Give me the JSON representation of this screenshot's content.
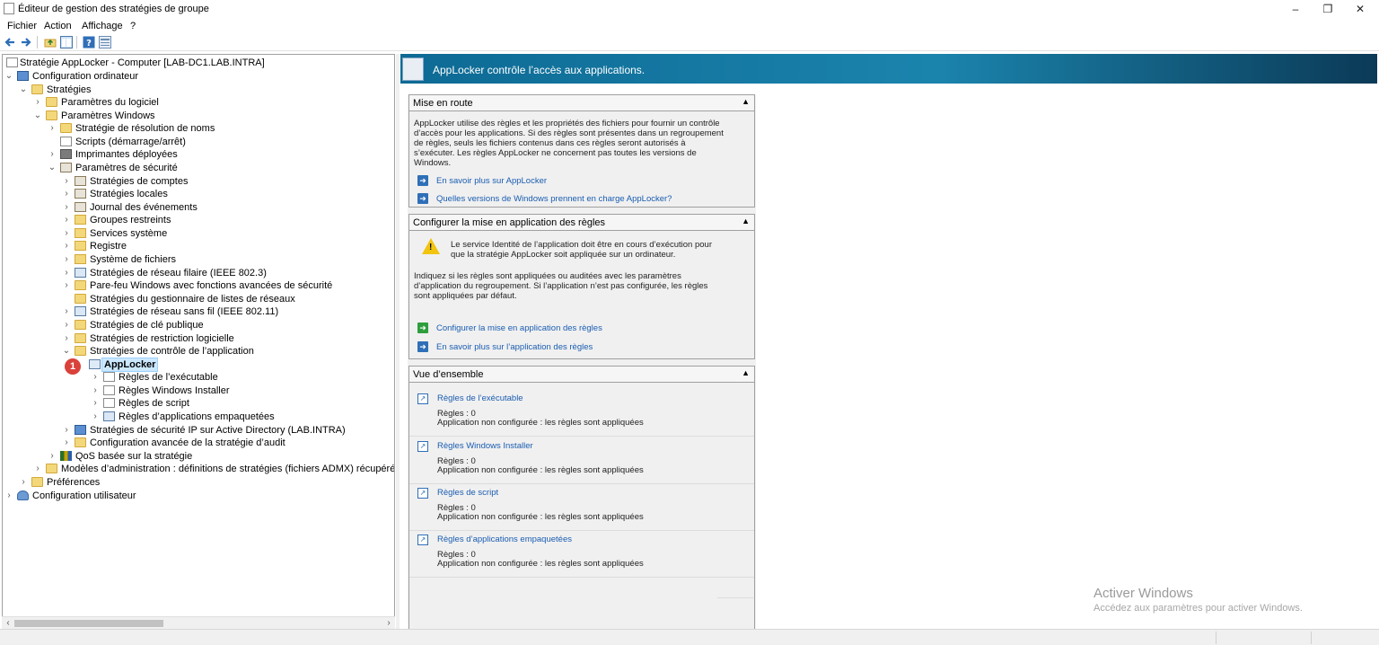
{
  "window": {
    "title": "Éditeur de gestion des stratégies de groupe",
    "minimize": "–",
    "restore": "❐",
    "close": "✕"
  },
  "menu": [
    "Fichier",
    "Action",
    "Affichage",
    "?"
  ],
  "toolbar": [
    "back-icon",
    "forward-icon",
    "up-folder-icon",
    "show-hide-tree-icon",
    "help-icon",
    "properties-icon"
  ],
  "tree": {
    "nodes": [
      {
        "label": "Stratégie AppLocker - Computer [LAB-DC1.LAB.INTRA]",
        "icon": "policy-icon"
      },
      {
        "label": "Configuration ordinateur",
        "icon": "computer-icon"
      },
      {
        "label": "Stratégies",
        "icon": "folder-icon"
      },
      {
        "label": "Paramètres du logiciel",
        "icon": "folder-icon"
      },
      {
        "label": "Paramètres Windows",
        "icon": "folder-icon"
      },
      {
        "label": "Stratégie de résolution de noms",
        "icon": "folder-icon"
      },
      {
        "label": "Scripts (démarrage/arrêt)",
        "icon": "script-icon"
      },
      {
        "label": "Imprimantes déployées",
        "icon": "printer-icon"
      },
      {
        "label": "Paramètres de sécurité",
        "icon": "security-icon"
      },
      {
        "label": "Stratégies de comptes",
        "icon": "security-icon"
      },
      {
        "label": "Stratégies locales",
        "icon": "security-icon"
      },
      {
        "label": "Journal des événements",
        "icon": "security-icon"
      },
      {
        "label": "Groupes restreints",
        "icon": "lock-folder-icon"
      },
      {
        "label": "Services système",
        "icon": "lock-folder-icon"
      },
      {
        "label": "Registre",
        "icon": "lock-folder-icon"
      },
      {
        "label": "Système de fichiers",
        "icon": "lock-folder-icon"
      },
      {
        "label": "Stratégies de réseau filaire (IEEE 802.3)",
        "icon": "network-icon"
      },
      {
        "label": "Pare-feu Windows avec fonctions avancées de sécurité",
        "icon": "folder-icon"
      },
      {
        "label": "Stratégies du gestionnaire de listes de réseaux",
        "icon": "folder-icon"
      },
      {
        "label": "Stratégies de réseau sans fil (IEEE 802.11)",
        "icon": "wireless-icon"
      },
      {
        "label": "Stratégies de clé publique",
        "icon": "folder-icon"
      },
      {
        "label": "Stratégies de restriction logicielle",
        "icon": "folder-icon"
      },
      {
        "label": "Stratégies de contrôle de l’application",
        "icon": "folder-icon"
      },
      {
        "label": "AppLocker",
        "icon": "applocker-icon"
      },
      {
        "label": "Règles de l’exécutable",
        "icon": "executable-icon"
      },
      {
        "label": "Règles Windows Installer",
        "icon": "installer-icon"
      },
      {
        "label": "Règles de script",
        "icon": "script-icon"
      },
      {
        "label": "Règles d’applications empaquetées",
        "icon": "packaged-app-icon"
      },
      {
        "label": "Stratégies de sécurité IP sur Active Directory (LAB.INTRA)",
        "icon": "ipsec-icon"
      },
      {
        "label": "Configuration avancée de la stratégie d’audit",
        "icon": "folder-icon"
      },
      {
        "label": "QoS basée sur la stratégie",
        "icon": "chart-icon"
      },
      {
        "label": "Modèles d’administration : définitions de stratégies (fichiers ADMX) récupérées à partir",
        "icon": "folder-icon"
      },
      {
        "label": "Préférences",
        "icon": "folder-icon"
      },
      {
        "label": "Configuration utilisateur",
        "icon": "user-icon"
      }
    ],
    "callout": "1"
  },
  "banner": {
    "title": "AppLocker contrôle l’accès aux applications."
  },
  "sections": {
    "getting_started": {
      "title": "Mise en route",
      "text": "AppLocker utilise des règles et les propriétés des fichiers pour fournir un contrôle d’accès pour les applications. Si des règles sont présentes dans un regroupement de règles, seuls les fichiers contenus dans ces règles seront autorisés à s’exécuter. Les règles AppLocker ne concernent pas toutes les versions de Windows.",
      "links": [
        "En savoir plus sur AppLocker",
        "Quelles versions de Windows prennent en charge AppLocker?"
      ]
    },
    "enforcement": {
      "title": "Configurer la mise en application des règles",
      "warning": "Le service Identité de l’application doit être en cours d’exécution pour que la stratégie AppLocker soit appliquée sur un ordinateur.",
      "text": "Indiquez si les règles sont appliquées ou auditées avec les paramètres d’application du regroupement. Si l’application n’est pas configurée, les règles sont appliquées par défaut.",
      "links": [
        "Configurer la mise en application des règles",
        "En savoir plus sur l’application des règles"
      ]
    },
    "overview": {
      "title": "Vue d’ensemble",
      "items": [
        {
          "title": "Règles de l’exécutable",
          "count": "Règles : 0",
          "status": "Application non configurée : les règles sont appliquées"
        },
        {
          "title": "Règles Windows Installer",
          "count": "Règles : 0",
          "status": "Application non configurée : les règles sont appliquées"
        },
        {
          "title": "Règles de script",
          "count": "Règles : 0",
          "status": "Application non configurée : les règles sont appliquées"
        },
        {
          "title": "Règles d’applications empaquetées",
          "count": "Règles : 0",
          "status": "Application non configurée : les règles sont appliquées"
        }
      ]
    }
  },
  "watermark": {
    "line1": "Activer Windows",
    "line2": "Accédez aux paramètres pour activer Windows."
  }
}
